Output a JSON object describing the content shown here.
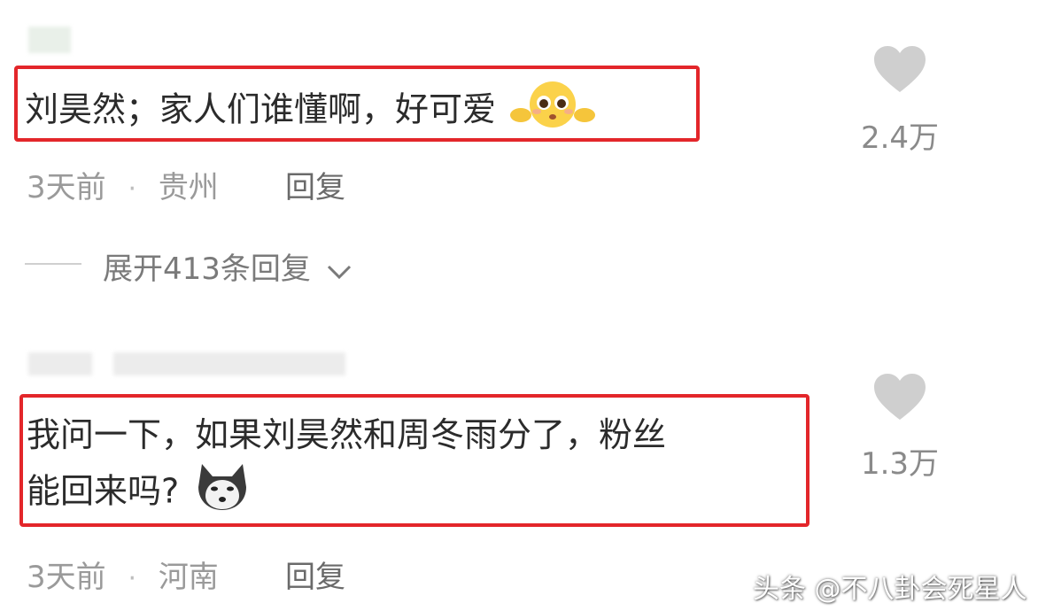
{
  "comments": [
    {
      "text": "刘昊然；家人们谁懂啊，好可爱",
      "emoji": "pleading-face-emoji",
      "time": "3天前",
      "separator": "·",
      "location": "贵州",
      "reply_label": "回复",
      "like_count": "2.4万",
      "expand_label": "展开413条回复"
    },
    {
      "text_line1": "我问一下，如果刘昊然和周冬雨分了，粉丝",
      "text_line2": "能回来吗?",
      "emoji": "husky-dog-emoji",
      "time": "3天前",
      "separator": "·",
      "location": "河南",
      "reply_label": "回复",
      "like_count": "1.3万"
    }
  ],
  "watermark": "头条 @不八卦会死星人",
  "colors": {
    "highlight_border": "#e3262a",
    "heart": "#cfcfcf",
    "meta_text": "#9a9a9a"
  }
}
